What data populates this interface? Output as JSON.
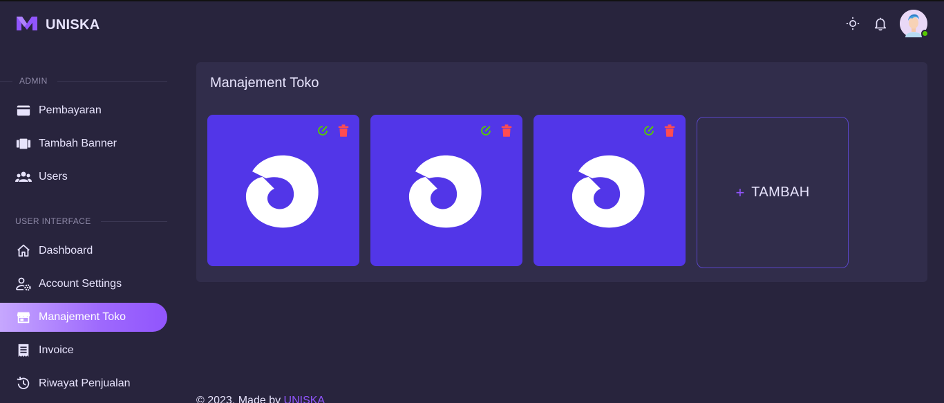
{
  "brand": {
    "name": "UNISKA"
  },
  "sidebar": {
    "sections": [
      {
        "title": "ADMIN"
      },
      {
        "title": "USER INTERFACE"
      }
    ],
    "items": [
      {
        "label": "Pembayaran",
        "icon": "credit-card-icon"
      },
      {
        "label": "Tambah Banner",
        "icon": "view-carousel-icon"
      },
      {
        "label": "Users",
        "icon": "account-group-icon"
      },
      {
        "label": "Dashboard",
        "icon": "home-icon"
      },
      {
        "label": "Account Settings",
        "icon": "account-cog-icon"
      },
      {
        "label": "Manajement Toko",
        "icon": "storefront-icon",
        "active": true
      },
      {
        "label": "Invoice",
        "icon": "receipt-icon"
      },
      {
        "label": "Riwayat Penjualan",
        "icon": "history-icon"
      }
    ]
  },
  "header": {
    "icons": [
      "brightness-icon",
      "bell-icon",
      "avatar"
    ],
    "status": "online"
  },
  "main": {
    "title": "Manajement Toko",
    "stores": [
      {
        "edit_icon": "edit-icon",
        "delete_icon": "trash-icon"
      },
      {
        "edit_icon": "edit-icon",
        "delete_icon": "trash-icon"
      },
      {
        "edit_icon": "edit-icon",
        "delete_icon": "trash-icon"
      }
    ],
    "add_label": "TAMBAH",
    "add_symbol": "+"
  },
  "footer": {
    "text": "© 2023, Made by ",
    "link": "UNISKA"
  },
  "colors": {
    "background": "#28243d",
    "card": "#312d4b",
    "primary": "#9155fd",
    "store_tile": "#5236e8",
    "edit": "#56ca00",
    "delete": "#ff4c51"
  }
}
